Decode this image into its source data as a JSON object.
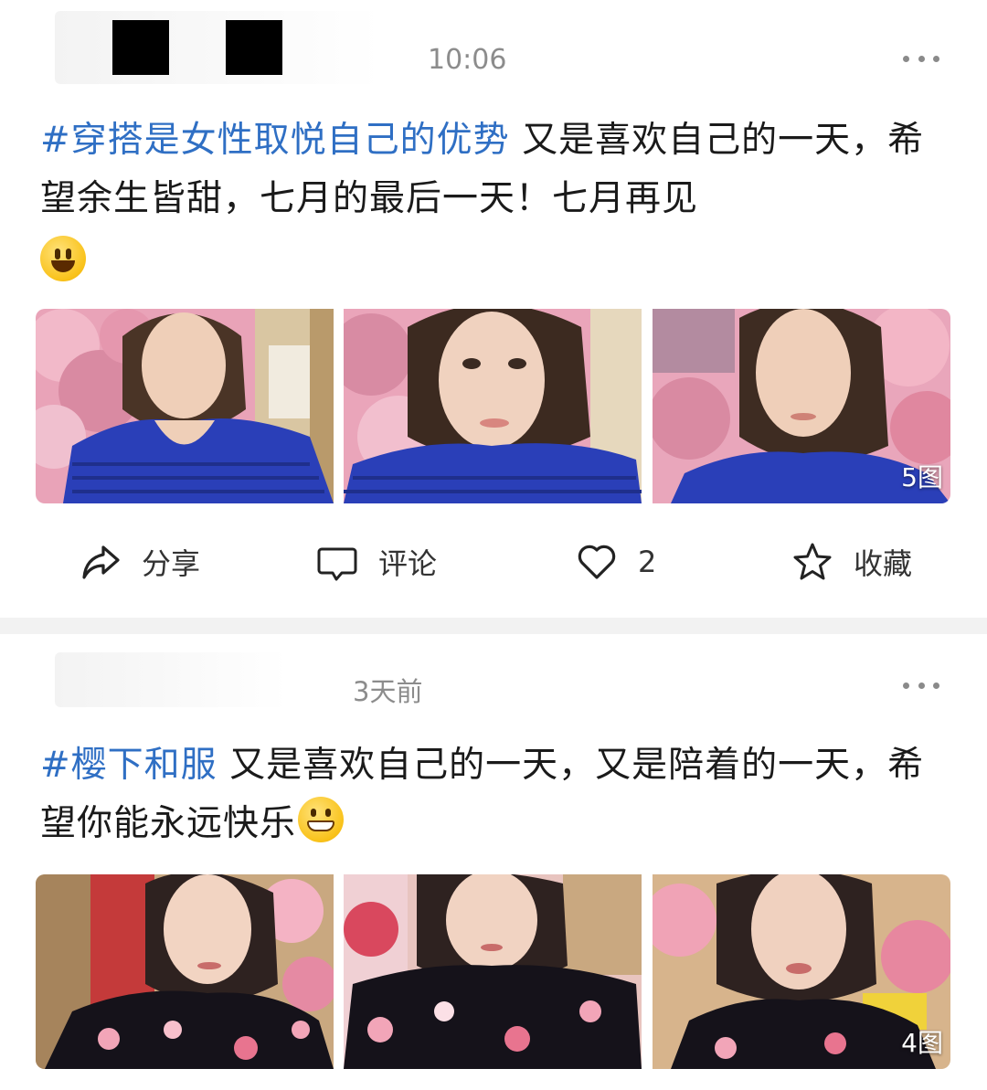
{
  "posts": [
    {
      "timestamp": "10:06",
      "hashtag": "#穿搭是女性取悦自己的优势",
      "text": " 又是喜欢自己的一天，希望余生皆甜，七月的最后一天！七月再见",
      "emoji_icon": "grinning-face-emoji",
      "photo_count": "5图",
      "actions": {
        "share": "分享",
        "comment": "评论",
        "like_count": "2",
        "favorite": "收藏"
      }
    },
    {
      "timestamp": "3天前",
      "hashtag": "#樱下和服",
      "text": " 又是喜欢自己的一天，又是陪着的一天，希望你能永远快乐",
      "emoji_icon": "beaming-face-emoji",
      "photo_count": "4图"
    }
  ],
  "colors": {
    "hashtag": "#2f6fc4",
    "divider": "#f2f2f2",
    "meta_text": "#8c8c8c",
    "blossom_pink": "#e78aa5",
    "dress_blue": "#2a3fb8"
  }
}
